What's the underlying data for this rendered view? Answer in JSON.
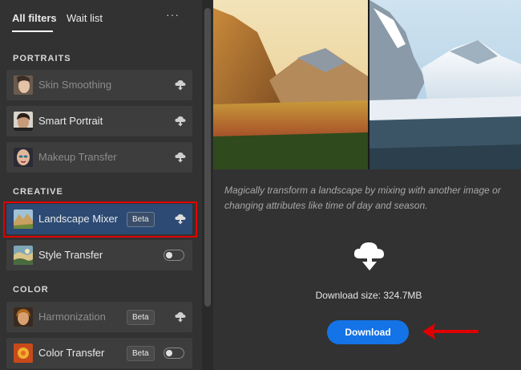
{
  "tabs": [
    {
      "label": "All filters",
      "active": true
    },
    {
      "label": "Wait list",
      "active": false
    }
  ],
  "more_label": "···",
  "sections": {
    "portraits": "PORTRAITS",
    "creative": "CREATIVE",
    "color": "COLOR"
  },
  "filters": {
    "skin_smoothing": {
      "label": "Skin Smoothing",
      "status": "cloud"
    },
    "smart_portrait": {
      "label": "Smart Portrait",
      "status": "cloud"
    },
    "makeup_transfer": {
      "label": "Makeup Transfer",
      "status": "cloud"
    },
    "landscape_mixer": {
      "label": "Landscape Mixer",
      "badge": "Beta",
      "status": "cloud",
      "selected": true
    },
    "style_transfer": {
      "label": "Style Transfer",
      "status": "toggle-off"
    },
    "harmonization": {
      "label": "Harmonization",
      "badge": "Beta",
      "status": "cloud"
    },
    "color_transfer": {
      "label": "Color Transfer",
      "badge": "Beta",
      "status": "toggle-off"
    }
  },
  "detail": {
    "description": "Magically transform a landscape by mixing with another image or changing attributes like time of day and season.",
    "download_size": "Download size: 324.7MB",
    "download_label": "Download"
  },
  "colors": {
    "accent": "#1473e6",
    "selected_bg": "#2c4a73",
    "annotation": "#e00000"
  }
}
